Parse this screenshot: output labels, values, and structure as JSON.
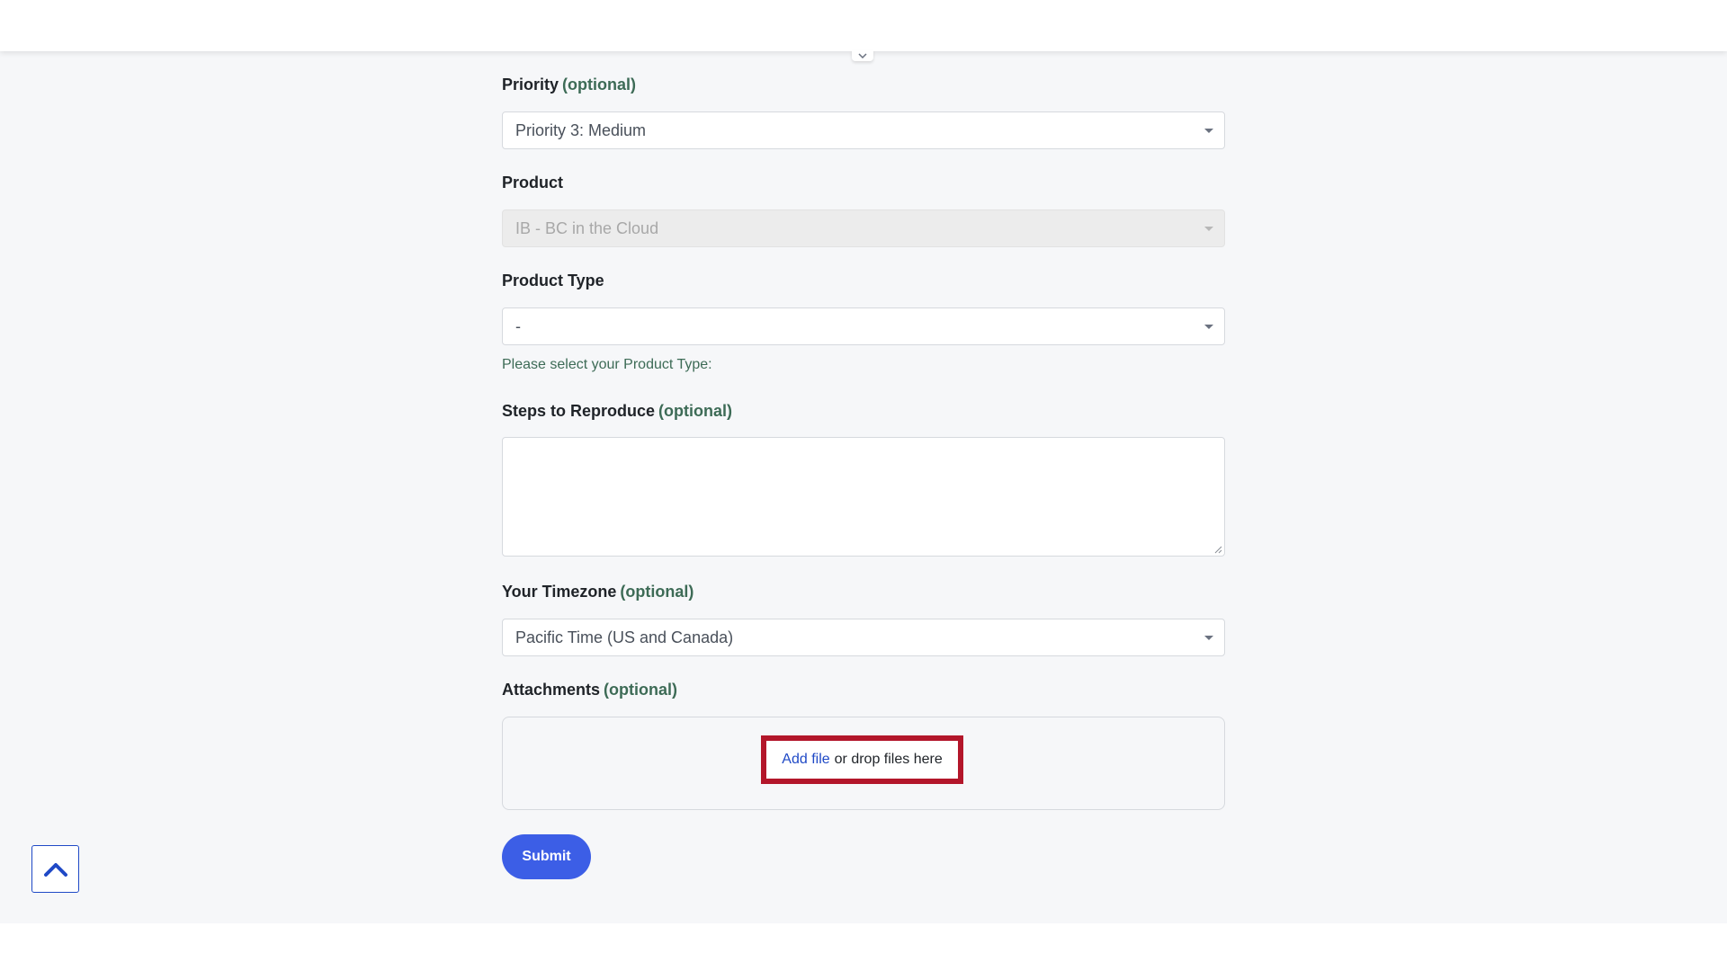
{
  "form": {
    "optional_marker": "(optional)",
    "priority": {
      "label": "Priority",
      "value": "Priority 3: Medium"
    },
    "product": {
      "label": "Product",
      "value": "IB - BC in the Cloud",
      "disabled": true
    },
    "product_type": {
      "label": "Product Type",
      "value": "-",
      "hint": "Please select your Product Type:"
    },
    "steps_to_reproduce": {
      "label": "Steps to Reproduce",
      "value": ""
    },
    "timezone": {
      "label": "Your Timezone",
      "value": "Pacific Time (US and Canada)"
    },
    "attachments": {
      "label": "Attachments",
      "add_file_link": "Add file",
      "drop_text": "or drop files here"
    },
    "submit_label": "Submit"
  },
  "icons": {
    "back_to_top": "chevron-up-icon",
    "header_toggle": "chevron-down-icon"
  },
  "colors": {
    "accent": "#3c5ee6",
    "link": "#1f49c6",
    "optional_text": "#3d6b56",
    "highlight_border": "#b3162a",
    "page_background": "#f6f7f9"
  }
}
